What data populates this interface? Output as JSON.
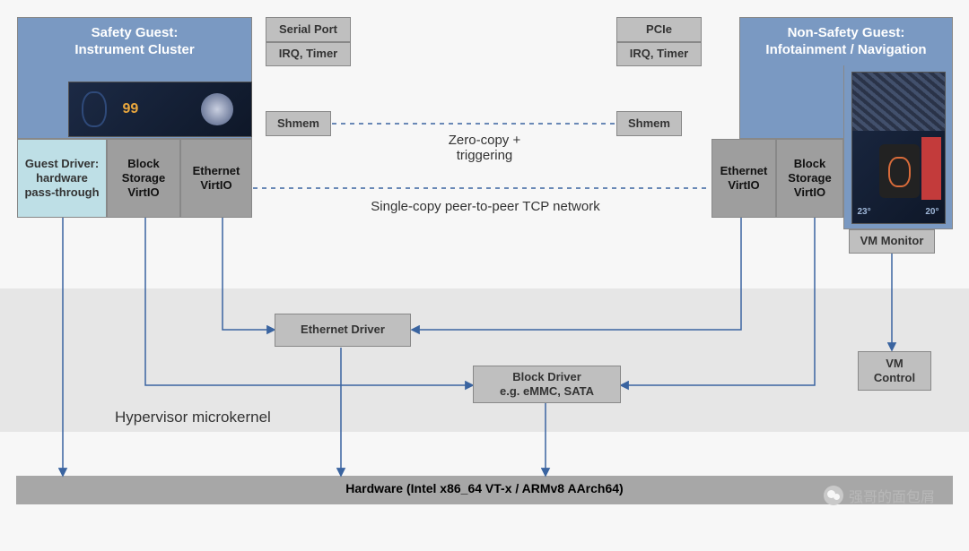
{
  "safety_guest": {
    "title": "Safety Guest:\nInstrument Cluster",
    "guest_driver": "Guest Driver:\nhardware\npass-through",
    "block_storage": "Block\nStorage\nVirtIO",
    "ethernet": "Ethernet\nVirtIO"
  },
  "non_safety_guest": {
    "title": "Non-Safety Guest:\nInfotainment / Navigation",
    "ethernet": "Ethernet\nVirtIO",
    "block_storage": "Block\nStorage\nVirtIO",
    "vm_monitor": "VM Monitor"
  },
  "passthrough_left": {
    "serial": "Serial Port",
    "irq": "IRQ, Timer",
    "shmem": "Shmem"
  },
  "passthrough_right": {
    "pcie": "PCIe",
    "irq": "IRQ, Timer",
    "shmem": "Shmem"
  },
  "center_labels": {
    "zerocopy": "Zero-copy +\ntriggering",
    "tcp": "Single-copy peer-to-peer TCP network"
  },
  "hypervisor": {
    "ethernet_driver": "Ethernet Driver",
    "block_driver": "Block Driver\ne.g. eMMC, SATA",
    "label": "Hypervisor microkernel",
    "vm_control": "VM\nControl"
  },
  "hardware": {
    "label": "Hardware (Intel x86_64 VT-x / ARMv8 AArch64)"
  },
  "watermark": "强哥的面包屑"
}
